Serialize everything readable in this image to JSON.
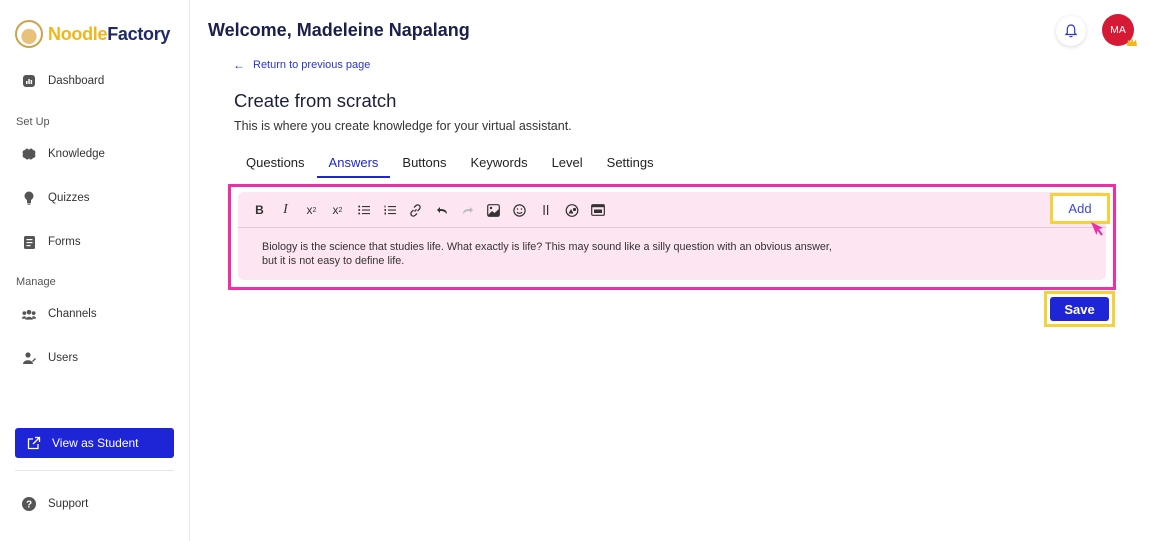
{
  "brand": {
    "logo_part1": "Noodle",
    "logo_part2": "Factory"
  },
  "sidebar": {
    "dashboard": "Dashboard",
    "setup_label": "Set Up",
    "knowledge": "Knowledge",
    "quizzes": "Quizzes",
    "forms": "Forms",
    "manage_label": "Manage",
    "channels": "Channels",
    "users": "Users",
    "view_as_student": "View as Student",
    "support": "Support"
  },
  "header": {
    "welcome": "Welcome, Madeleine Napalang",
    "avatar_initials": "MA"
  },
  "page": {
    "back_link": "Return to previous page",
    "title": "Create from scratch",
    "subtitle": "This is where you create knowledge for your virtual assistant."
  },
  "tabs": [
    "Questions",
    "Answers",
    "Buttons",
    "Keywords",
    "Level",
    "Settings"
  ],
  "active_tab": "Answers",
  "editor": {
    "text_line1": "Biology is the science that studies life. What exactly is life? This may sound like a silly question with an obvious answer,",
    "text_line2": "but it is not easy to define life.",
    "add_label": "Add"
  },
  "save_label": "Save",
  "colors": {
    "primary": "#1e25d6",
    "highlight_pink": "#ef2fa7",
    "highlight_yellow": "#f5d13c",
    "editor_bg": "#fde6f1",
    "avatar_bg": "#d61a36"
  }
}
